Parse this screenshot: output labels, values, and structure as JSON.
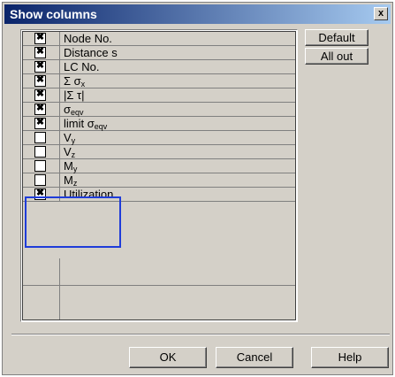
{
  "window": {
    "title": "Show columns",
    "close_label": "x"
  },
  "rows": [
    {
      "checked": true,
      "label": "Node No.",
      "sub": ""
    },
    {
      "checked": true,
      "label": "Distance s",
      "sub": ""
    },
    {
      "checked": true,
      "label": "LC No.",
      "sub": ""
    },
    {
      "checked": true,
      "label": "Σ σ",
      "sub": "x"
    },
    {
      "checked": true,
      "label": "|Σ τ|",
      "sub": ""
    },
    {
      "checked": true,
      "label": "σ",
      "sub": "eqv"
    },
    {
      "checked": true,
      "label": "limit σ",
      "sub": "eqv"
    },
    {
      "checked": false,
      "label": "V",
      "sub": "y"
    },
    {
      "checked": false,
      "label": "V",
      "sub": "z"
    },
    {
      "checked": false,
      "label": "M",
      "sub": "y"
    },
    {
      "checked": false,
      "label": "M",
      "sub": "z"
    },
    {
      "checked": true,
      "label": "Utilization",
      "sub": ""
    }
  ],
  "checkbox_mark": "✖",
  "side_buttons": {
    "default_label": "Default",
    "all_out_label": "All out"
  },
  "bottom_buttons": {
    "ok_label": "OK",
    "cancel_label": "Cancel",
    "help_label": "Help"
  },
  "colors": {
    "title_start": "#0a246a",
    "title_end": "#a6caf0",
    "highlight": "#1f3cd9",
    "dialog_bg": "#d4d0c8"
  }
}
